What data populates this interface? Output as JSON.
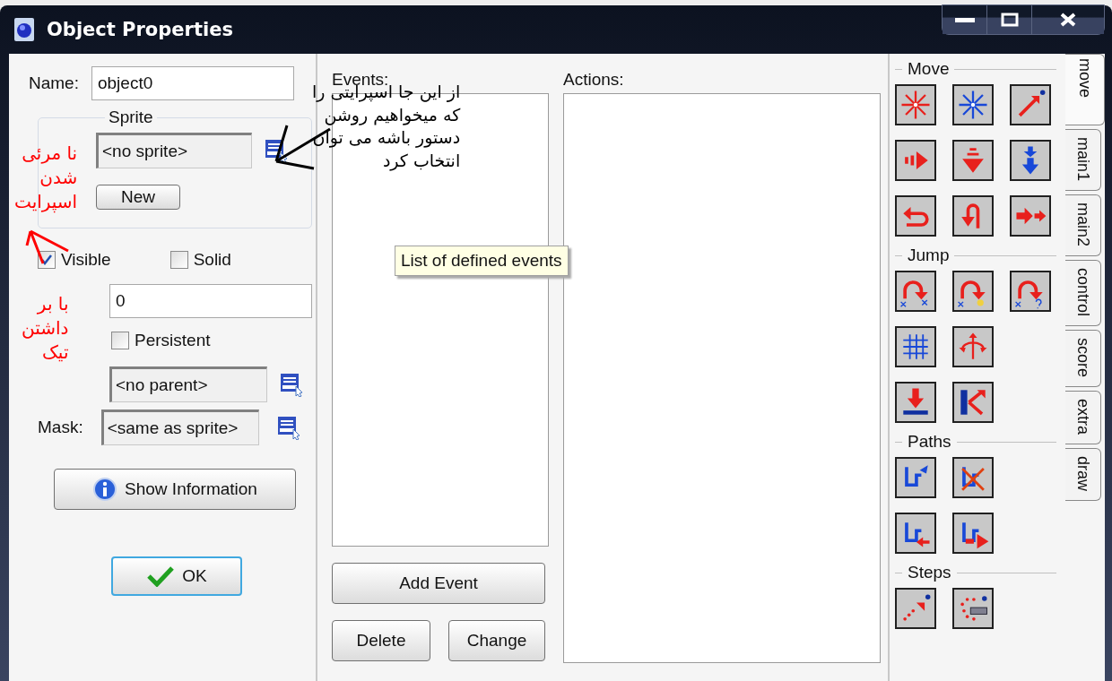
{
  "window": {
    "title": "Object Properties"
  },
  "properties": {
    "name_label": "Name:",
    "name_value": "object0",
    "sprite_group": "Sprite",
    "sprite_value": "<no sprite>",
    "new_button": "New",
    "checkboxes": [
      {
        "label": "Visible",
        "checked": true
      },
      {
        "label": "Solid",
        "checked": false
      }
    ],
    "depth_value": "0",
    "persistent": {
      "label": "Persistent",
      "checked": false
    },
    "parent_value": "<no parent>",
    "mask_label": "Mask:",
    "mask_value": "<same as sprite>",
    "info_button": "Show Information",
    "ok_button": "OK"
  },
  "events": {
    "label": "Events:",
    "tooltip": "List of defined events",
    "buttons": [
      "Add Event",
      "Delete",
      "Change"
    ]
  },
  "actions": {
    "label": "Actions:"
  },
  "palette": {
    "groups": [
      {
        "title": "Move"
      },
      {
        "title": "Jump"
      },
      {
        "title": "Paths"
      },
      {
        "title": "Steps"
      }
    ],
    "tabs": [
      {
        "label": "move",
        "selected": true
      },
      {
        "label": "main1",
        "selected": false
      },
      {
        "label": "main2",
        "selected": false
      },
      {
        "label": "control",
        "selected": false
      },
      {
        "label": "score",
        "selected": false
      },
      {
        "label": "extra",
        "selected": false
      },
      {
        "label": "draw",
        "selected": false
      }
    ]
  },
  "annotations": [
    {
      "lines": [
        "نا مرئی",
        "شدن",
        "اسپرایت"
      ],
      "color": "#ff0000"
    },
    {
      "lines": [
        "با بر",
        "داشتن",
        "تیک"
      ],
      "color": "#ff0000"
    },
    {
      "lines": [
        "از این جا اسپرایتی را",
        "که میخواهیم روشن",
        "دستور باشه می توان",
        "انتخاب کرد"
      ],
      "color": "#000000"
    }
  ]
}
